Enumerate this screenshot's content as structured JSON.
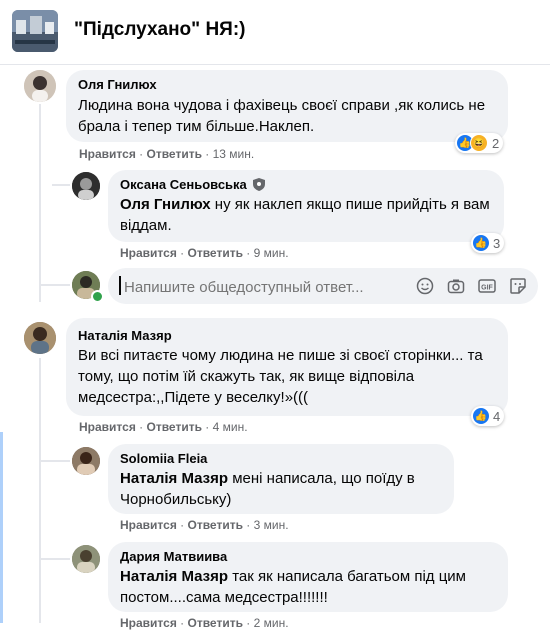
{
  "group": {
    "title": "\"Підслухано\" НЯ:)"
  },
  "comments": [
    {
      "author": "Оля Гнилюх",
      "text": "Людина вона чудова і фахівець своєї справи ,як колись не брала і тепер тим більше.Наклеп.",
      "like_label": "Нравится",
      "reply_label": "Ответить",
      "time": "13 мин.",
      "reactions_count": "2"
    },
    {
      "author": "Оксана Сеньовська",
      "mention": "Оля Гнилюх",
      "text": " ну як наклеп якщо пише прийдіть я вам віддам.",
      "like_label": "Нравится",
      "reply_label": "Ответить",
      "time": "9 мин.",
      "reactions_count": "3"
    },
    {
      "author": "Наталія Мазяр",
      "text": "Ви всі питаєте чому людина не пише зі своєї сторінки... та тому, що потім їй скажуть так, як вище відповіла медсестра:,,Підете у веселку!»(((",
      "like_label": "Нравится",
      "reply_label": "Ответить",
      "time": "4 мин.",
      "reactions_count": "4"
    },
    {
      "author": "Solomiia Fleia",
      "mention": "Наталія Мазяр",
      "text": " мені написала, що поїду в Чорнобильську)",
      "like_label": "Нравится",
      "reply_label": "Ответить",
      "time": "3 мин."
    },
    {
      "author": "Дария Матвиива",
      "mention": "Наталія Мазяр",
      "text": " так як написала багатьом під цим постом....сама медсестра!!!!!!!",
      "like_label": "Нравится",
      "reply_label": "Ответить",
      "time": "2 мин."
    }
  ],
  "composer": {
    "placeholder": "Напишите общедоступный ответ..."
  },
  "icons": {
    "emoji": "emoji-icon",
    "camera": "camera-icon",
    "gif": "gif-icon",
    "sticker": "sticker-icon",
    "badge": "shield-badge-icon"
  },
  "colors": {
    "like": "#1877f2",
    "bubble": "#f0f2f5",
    "meta": "#65676b"
  }
}
